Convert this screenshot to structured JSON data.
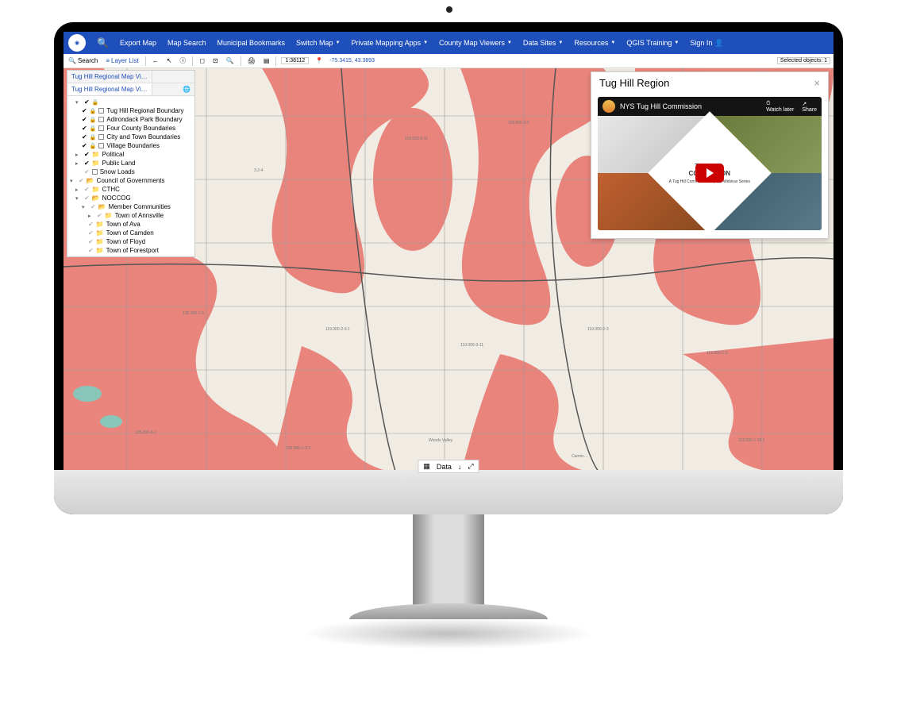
{
  "navbar": {
    "items": [
      {
        "label": "Export Map"
      },
      {
        "label": "Map Search"
      },
      {
        "label": "Municipal Bookmarks"
      },
      {
        "label": "Switch Map",
        "dropdown": true
      },
      {
        "label": "Private Mapping Apps",
        "dropdown": true
      },
      {
        "label": "County Map Viewers",
        "dropdown": true
      },
      {
        "label": "Data Sites",
        "dropdown": true
      },
      {
        "label": "Resources",
        "dropdown": true
      },
      {
        "label": "QGIS Training",
        "dropdown": true
      },
      {
        "label": "Sign In",
        "icon_right": "user"
      }
    ]
  },
  "toolbar": {
    "search_label": "Search",
    "layer_list_label": "Layer List",
    "scale": "1:38112",
    "coords": "-75.3415, 43.3893",
    "selected_label": "Selected objects:",
    "selected_count": "1"
  },
  "layer_panel": {
    "tab_active": "Tug Hill Regional Map Vi…",
    "tab_other": "Tug Hill Regional Map Vi…",
    "legend_items": [
      {
        "label": "Tug Hill Regional Boundary"
      },
      {
        "label": "Adirondack Park Boundary"
      },
      {
        "label": "Four County Boundaries"
      },
      {
        "label": "City and Town Boundaries"
      },
      {
        "label": "Village Boundaries"
      }
    ],
    "folders_top": [
      {
        "label": "Political"
      },
      {
        "label": "Public Land"
      }
    ],
    "snow_loads": "Snow Loads",
    "council": "Council of Governments",
    "cthc": "CTHC",
    "noccog": "NOCCOG",
    "member_communities": "Member Communities",
    "towns": [
      "Town of Annsville",
      "Town of Ava",
      "Town of Camden",
      "Town of Floyd",
      "Town of Forestport"
    ]
  },
  "info_popup": {
    "title": "Tug Hill Region",
    "video_title": "NYS Tug Hill Commission",
    "watch_later": "Watch later",
    "share": "Share",
    "diamond_line1": "TUG HILL",
    "diamond_line2": "COMMISSION",
    "diamond_sub": "A Tug Hill Commission Topical Webinar Series"
  },
  "data_bar": {
    "label": "Data"
  },
  "colors": {
    "nav": "#1e4fbb",
    "map_overlay": "#e8736a",
    "map_bg": "#f0ece4",
    "water": "#6fd6c8"
  }
}
